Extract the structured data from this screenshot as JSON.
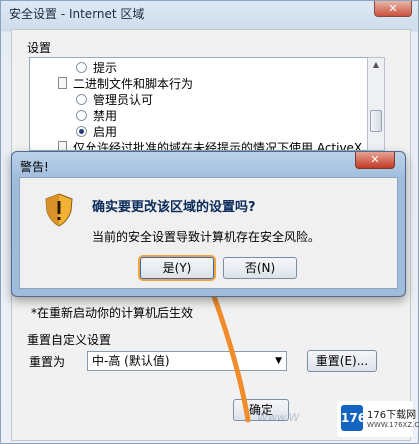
{
  "background_dialog": {
    "title": "安全设置 - Internet 区域",
    "group_label": "设置",
    "list_items": [
      {
        "kind": "radio",
        "checked": false,
        "label": "提示",
        "indent": 1
      },
      {
        "kind": "doc",
        "label": "二进制文件和脚本行为",
        "indent": 0
      },
      {
        "kind": "radio",
        "checked": false,
        "label": "管理员认可",
        "indent": 1
      },
      {
        "kind": "radio",
        "checked": false,
        "label": "禁用",
        "indent": 1
      },
      {
        "kind": "radio",
        "checked": true,
        "label": "启用",
        "indent": 1
      },
      {
        "kind": "doc",
        "label": "仅允许经过批准的域在未经提示的情况下使用 ActiveX",
        "indent": 0
      }
    ],
    "restart_note": "*在重新启动你的计算机后生效",
    "reset_section_label": "重置自定义设置",
    "reset_to_label": "重置为",
    "reset_select_value": "中-高 (默认值)",
    "reset_button": "重置(E)...",
    "ok_button": "确定",
    "watermark": "Www.W",
    "logo_text": "176下载网",
    "logo_sub": "WWW.176XZ.COM",
    "logo_badge": "176"
  },
  "modal": {
    "title": "警告!",
    "headline": "确实要更改该区域的设置吗?",
    "message": "当前的安全设置导致计算机存在安全风险。",
    "yes_button": "是(Y)",
    "no_button": "否(N)"
  },
  "colors": {
    "highlight_orange": "#f3a33a",
    "title_blue": "#0a2a5a"
  }
}
